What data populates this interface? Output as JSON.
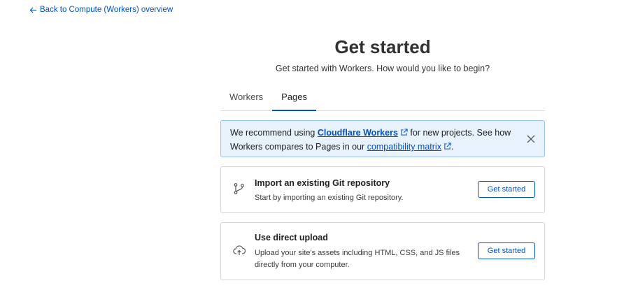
{
  "nav": {
    "back_label": "Back to Compute (Workers) overview"
  },
  "header": {
    "title": "Get started",
    "subtitle": "Get started with Workers. How would you like to begin?"
  },
  "tabs": [
    {
      "label": "Workers",
      "active": false
    },
    {
      "label": "Pages",
      "active": true
    }
  ],
  "banner": {
    "text_before": "We recommend using ",
    "link1": "Cloudflare Workers",
    "text_middle": " for new projects. See how Workers compares to Pages in our ",
    "link2": "compatibility matrix",
    "text_after": "."
  },
  "cards": [
    {
      "icon": "git-branch-icon",
      "title": "Import an existing Git repository",
      "description": "Start by importing an existing Git repository.",
      "button": "Get started"
    },
    {
      "icon": "cloud-upload-icon",
      "title": "Use direct upload",
      "description": "Upload your site's assets including HTML, CSS, and JS files directly from your computer.",
      "button": "Get started"
    }
  ],
  "colors": {
    "accent": "#0051c3",
    "banner_bg": "#e8f2fc",
    "banner_border": "#9bc3ef"
  }
}
